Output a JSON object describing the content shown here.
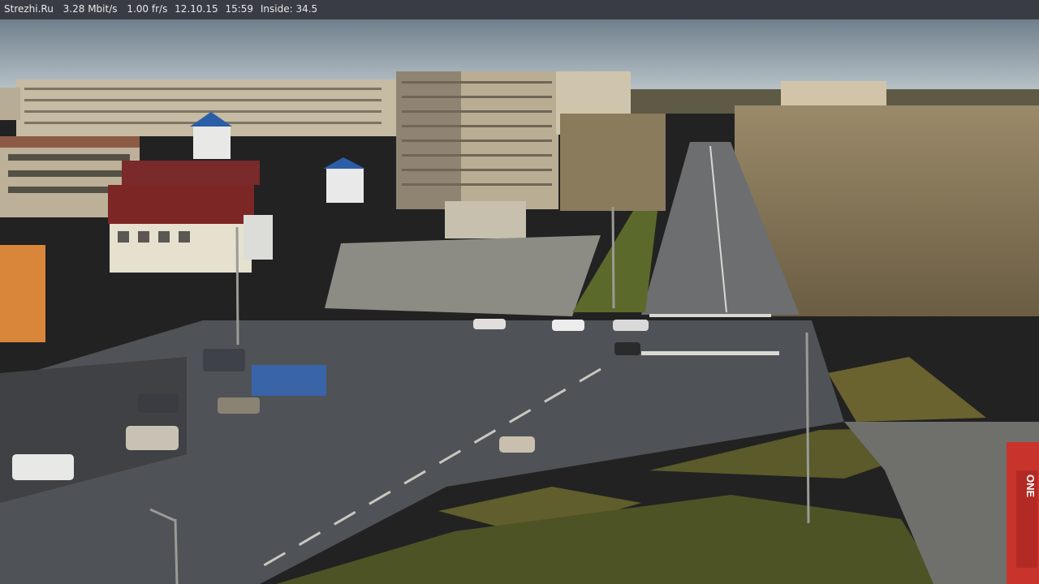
{
  "overlay": {
    "site": "Strezhi.Ru",
    "bitrate": "3.28 Mbit/s",
    "framerate": "1.00 fr/s",
    "date": "12.10.15",
    "time": "15:59",
    "temperature_label": "Inside: 34.5"
  },
  "scene": {
    "storefront_sign": "ONE"
  },
  "colors": {
    "sky_top": "#6f7f8c",
    "sky_bottom": "#b7c2c8",
    "road": "#4f5256",
    "grass": "#5b5f2c",
    "building": "#bfb7a4",
    "roof_red": "#7a2a2a",
    "roof_blue": "#2c5ea8"
  }
}
